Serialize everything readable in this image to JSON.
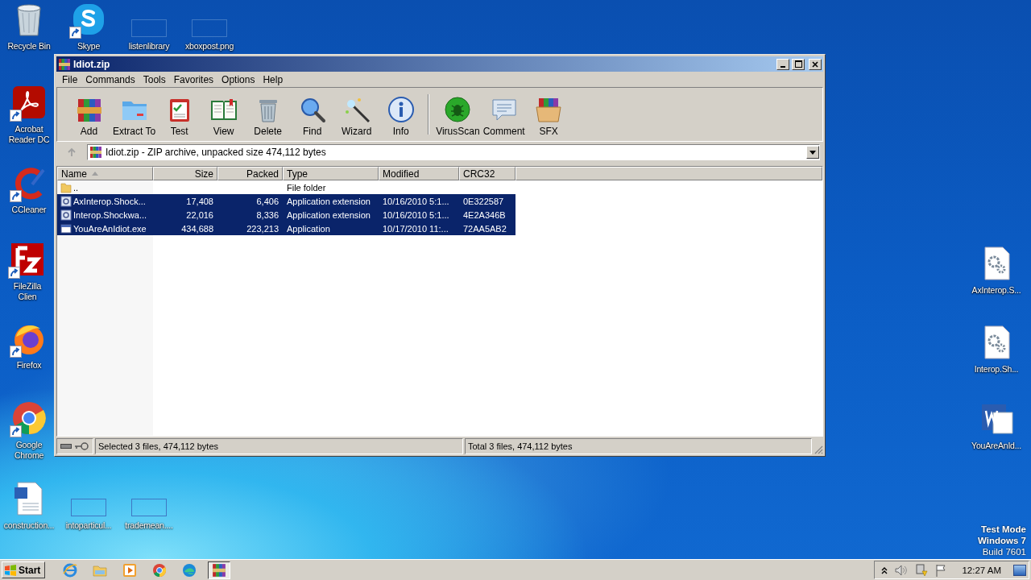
{
  "desktop_icons": [
    {
      "label": "Recycle Bin",
      "kind": "recycle",
      "shortcut": false
    },
    {
      "label": "Skype",
      "kind": "skype",
      "shortcut": true
    },
    {
      "label": "listenlibrary",
      "kind": "blank",
      "shortcut": false
    },
    {
      "label": "xboxpost.png",
      "kind": "blank",
      "shortcut": false
    },
    {
      "label": "Acrobat Reader DC",
      "kind": "acrobat",
      "shortcut": true
    },
    {
      "label": "CCleaner",
      "kind": "ccleaner",
      "shortcut": true
    },
    {
      "label": "FileZilla Clien",
      "kind": "filezilla",
      "shortcut": true
    },
    {
      "label": "Firefox",
      "kind": "firefox",
      "shortcut": true
    },
    {
      "label": "Google Chrome",
      "kind": "chrome",
      "shortcut": true
    },
    {
      "label": "construction...",
      "kind": "worddoc",
      "shortcut": false
    },
    {
      "label": "intoparticul...",
      "kind": "blank",
      "shortcut": false
    },
    {
      "label": "trademean....",
      "kind": "blank",
      "shortcut": false
    },
    {
      "label": "AxInterop.S...",
      "kind": "geardoc",
      "shortcut": false
    },
    {
      "label": "Interop.Sh...",
      "kind": "geardoc",
      "shortcut": false
    },
    {
      "label": "YouAreAnId...",
      "kind": "word",
      "shortcut": false
    }
  ],
  "system_notice": [
    "Test Mode",
    "Windows 7",
    "Build 7601"
  ],
  "window": {
    "title": "Idiot.zip",
    "menu": [
      "File",
      "Commands",
      "Tools",
      "Favorites",
      "Options",
      "Help"
    ],
    "toolbar": [
      {
        "buttons": [
          {
            "label": "Add",
            "kind": "add"
          },
          {
            "label": "Extract To",
            "kind": "extract"
          },
          {
            "label": "Test",
            "kind": "test"
          },
          {
            "label": "View",
            "kind": "view"
          },
          {
            "label": "Delete",
            "kind": "delete"
          },
          {
            "label": "Find",
            "kind": "find"
          },
          {
            "label": "Wizard",
            "kind": "wizard"
          },
          {
            "label": "Info",
            "kind": "info"
          }
        ]
      },
      {
        "buttons": [
          {
            "label": "VirusScan",
            "kind": "virusscan"
          },
          {
            "label": "Comment",
            "kind": "comment"
          },
          {
            "label": "SFX",
            "kind": "sfx"
          }
        ]
      }
    ],
    "address": "Idiot.zip - ZIP archive, unpacked size 474,112 bytes",
    "columns": [
      {
        "label": "Name",
        "sorted": true
      },
      {
        "label": "Size",
        "sorted": false
      },
      {
        "label": "Packed",
        "sorted": false
      },
      {
        "label": "Type",
        "sorted": false
      },
      {
        "label": "Modified",
        "sorted": false
      },
      {
        "label": "CRC32",
        "sorted": false
      }
    ],
    "rows": [
      {
        "kind": "folder",
        "name": "..",
        "type": "File folder",
        "selected": false
      },
      {
        "kind": "dll",
        "name": "AxInterop.Shock...",
        "size": "17,408",
        "packed": "6,406",
        "type": "Application extension",
        "modified": "10/16/2010 5:1...",
        "crc32": "0E322587",
        "selected": true
      },
      {
        "kind": "dll",
        "name": "Interop.Shockwa...",
        "size": "22,016",
        "packed": "8,336",
        "type": "Application extension",
        "modified": "10/16/2010 5:1...",
        "crc32": "4E2A346B",
        "selected": true
      },
      {
        "kind": "exe",
        "name": "YouAreAnIdiot.exe",
        "size": "434,688",
        "packed": "223,213",
        "type": "Application",
        "modified": "10/17/2010 11:...",
        "crc32": "72AA5AB2",
        "selected": true
      }
    ],
    "status_bar": [
      "Selected 3 files, 474,112 bytes",
      "Total 3 files, 474,112 bytes"
    ]
  },
  "taskbar": {
    "start": "Start",
    "apps": [
      {
        "kind": "ie",
        "active": false
      },
      {
        "kind": "explorer",
        "active": false
      },
      {
        "kind": "media",
        "active": false
      },
      {
        "kind": "chrome",
        "active": false
      },
      {
        "kind": "edge",
        "active": false
      },
      {
        "kind": "winrar",
        "active": true
      }
    ],
    "clock": "12:27 AM"
  }
}
